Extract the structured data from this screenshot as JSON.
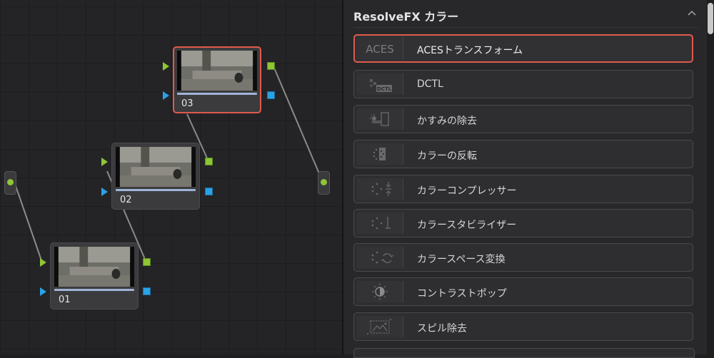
{
  "graph": {
    "nodes": [
      {
        "label": "01"
      },
      {
        "label": "02"
      },
      {
        "label": "03"
      }
    ]
  },
  "panel": {
    "title": "ResolveFX カラー",
    "items": [
      {
        "name": "ACESトランスフォーム",
        "icon": "aces-icon",
        "icon_text": "ACES",
        "selected": true
      },
      {
        "name": "DCTL",
        "icon": "dctl-icon",
        "icon_text": "DCTL"
      },
      {
        "name": "かすみの除去",
        "icon": "dehaze-icon"
      },
      {
        "name": "カラーの反転",
        "icon": "color-invert-icon"
      },
      {
        "name": "カラーコンプレッサー",
        "icon": "color-compressor-icon"
      },
      {
        "name": "カラースタビライザー",
        "icon": "color-stabilizer-icon"
      },
      {
        "name": "カラースペース変換",
        "icon": "color-space-transform-icon"
      },
      {
        "name": "コントラストポップ",
        "icon": "contrast-pop-icon"
      },
      {
        "name": "スピル除去",
        "icon": "despill-icon"
      }
    ]
  },
  "colors": {
    "selected_border": "#e05a4a",
    "port_green": "#8ec635",
    "port_blue": "#2aa2e6"
  }
}
